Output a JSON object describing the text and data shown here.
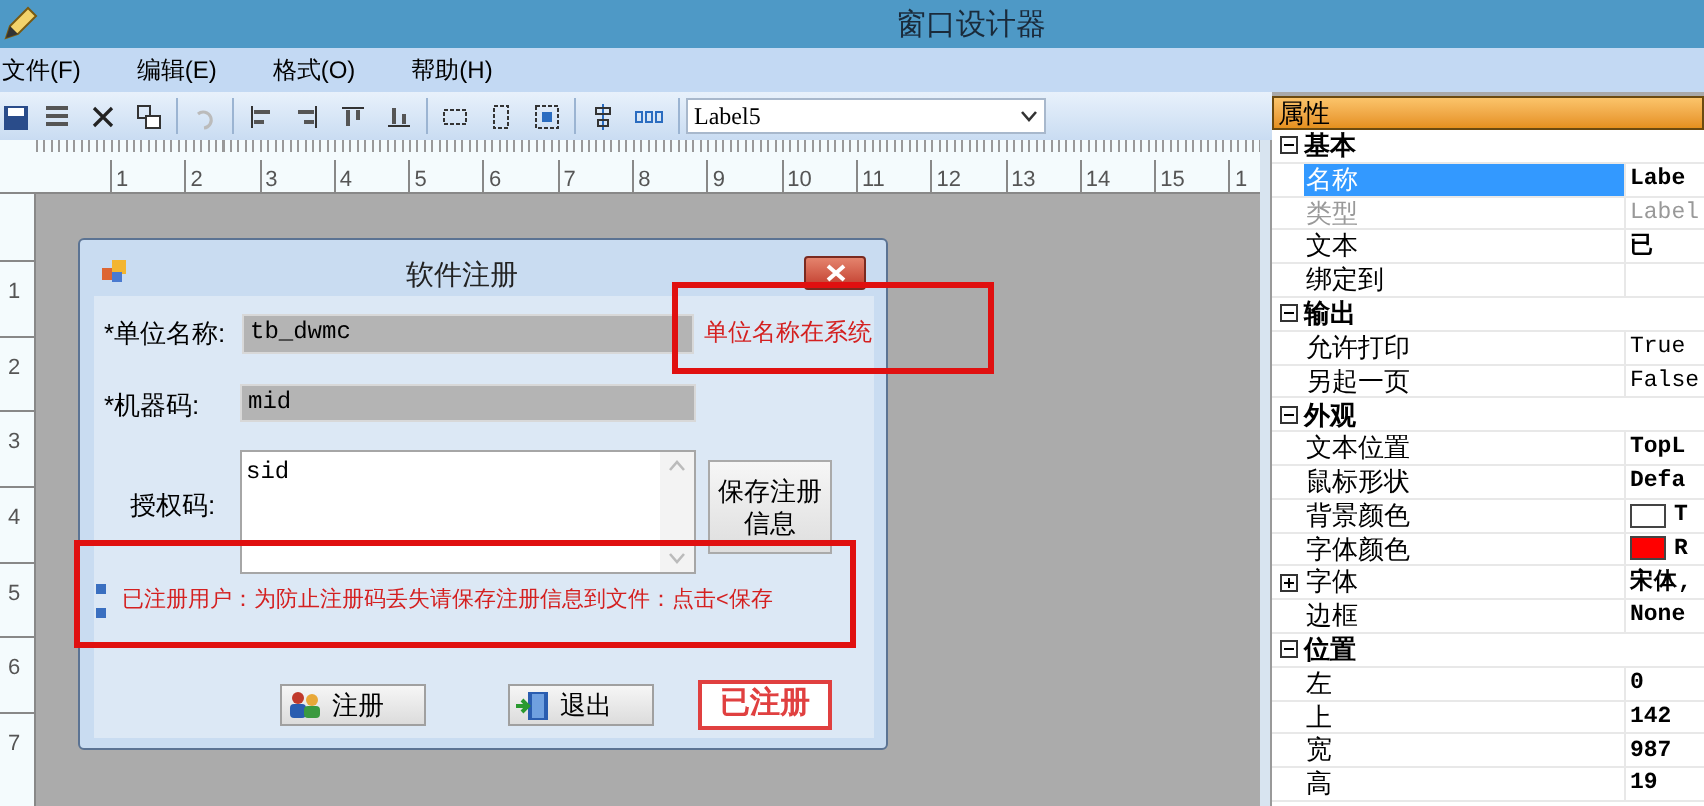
{
  "window": {
    "title": "窗口设计器"
  },
  "menu": [
    {
      "label": "文件(F)"
    },
    {
      "label": "编辑(E)"
    },
    {
      "label": "格式(O)"
    },
    {
      "label": "帮助(H)"
    }
  ],
  "toolbar": {
    "object_selector": "Label5"
  },
  "ruler": {
    "horizontal": [
      "1",
      "2",
      "3",
      "4",
      "5",
      "6",
      "7",
      "8",
      "9",
      "10",
      "11",
      "12",
      "13",
      "14",
      "15",
      "1"
    ],
    "vertical": [
      "1",
      "2",
      "3",
      "4",
      "5",
      "6",
      "7"
    ]
  },
  "dialog": {
    "title": "软件注册",
    "fields": [
      {
        "label": "*单位名称:",
        "value": "tb_dwmc",
        "kind": "text"
      },
      {
        "label": "*机器码:",
        "value": "mid",
        "kind": "text"
      },
      {
        "label": "授权码:",
        "value": "sid",
        "kind": "multiline"
      }
    ],
    "side_note": "单位名称在系统",
    "save_button": "保存注册信息",
    "notice": "已注册用户：为防止注册码丢失请保存注册信息到文件：点击<保存",
    "buttons": [
      {
        "label": "注册",
        "kind": "register"
      },
      {
        "label": "退出",
        "kind": "exit"
      }
    ],
    "status_badge": "已注册"
  },
  "properties": {
    "title": "属性",
    "groups": [
      {
        "name": "基本",
        "expanded": true,
        "rows": [
          {
            "name": "名称",
            "value": "Labe",
            "selected": true,
            "modified": true,
            "disabled": false
          },
          {
            "name": "类型",
            "value": "Label",
            "selected": false,
            "modified": false,
            "disabled": true
          },
          {
            "name": "文本",
            "value": "已",
            "selected": false,
            "modified": true,
            "disabled": false
          },
          {
            "name": "绑定到",
            "selected": false,
            "disabled": false
          }
        ]
      },
      {
        "name": "输出",
        "expanded": true,
        "rows": [
          {
            "name": "允许打印",
            "value": "True",
            "selected": false,
            "modified": false,
            "disabled": false
          },
          {
            "name": "另起一页",
            "value": "False",
            "selected": false,
            "modified": false,
            "disabled": false
          }
        ]
      },
      {
        "name": "外观",
        "expanded": true,
        "rows": [
          {
            "name": "文本位置",
            "value": "TopL",
            "selected": false,
            "modified": true,
            "disabled": false
          },
          {
            "name": "鼠标形状",
            "value": "Defa",
            "selected": false,
            "modified": true,
            "disabled": false
          },
          {
            "name": "背景颜色",
            "value": "T",
            "color": "#ffffff",
            "selected": false,
            "modified": true,
            "disabled": false
          },
          {
            "name": "字体颜色",
            "value": "R",
            "color": "#ff0000",
            "selected": false,
            "modified": true,
            "disabled": false
          },
          {
            "name": "字体",
            "value": "宋体,",
            "expandable": true,
            "expanded": false,
            "selected": false,
            "modified": true,
            "disabled": false
          },
          {
            "name": "边框",
            "value": "None",
            "selected": false,
            "modified": true,
            "disabled": false
          }
        ]
      },
      {
        "name": "位置",
        "expanded": true,
        "rows": [
          {
            "name": "左",
            "value": "0",
            "selected": false,
            "modified": true,
            "disabled": false
          },
          {
            "name": "上",
            "value": "142",
            "selected": false,
            "modified": true,
            "disabled": false
          },
          {
            "name": "宽",
            "value": "987",
            "selected": false,
            "modified": true,
            "disabled": false
          },
          {
            "name": "高",
            "value": "19",
            "selected": false,
            "modified": true,
            "disabled": false
          }
        ]
      }
    ]
  }
}
